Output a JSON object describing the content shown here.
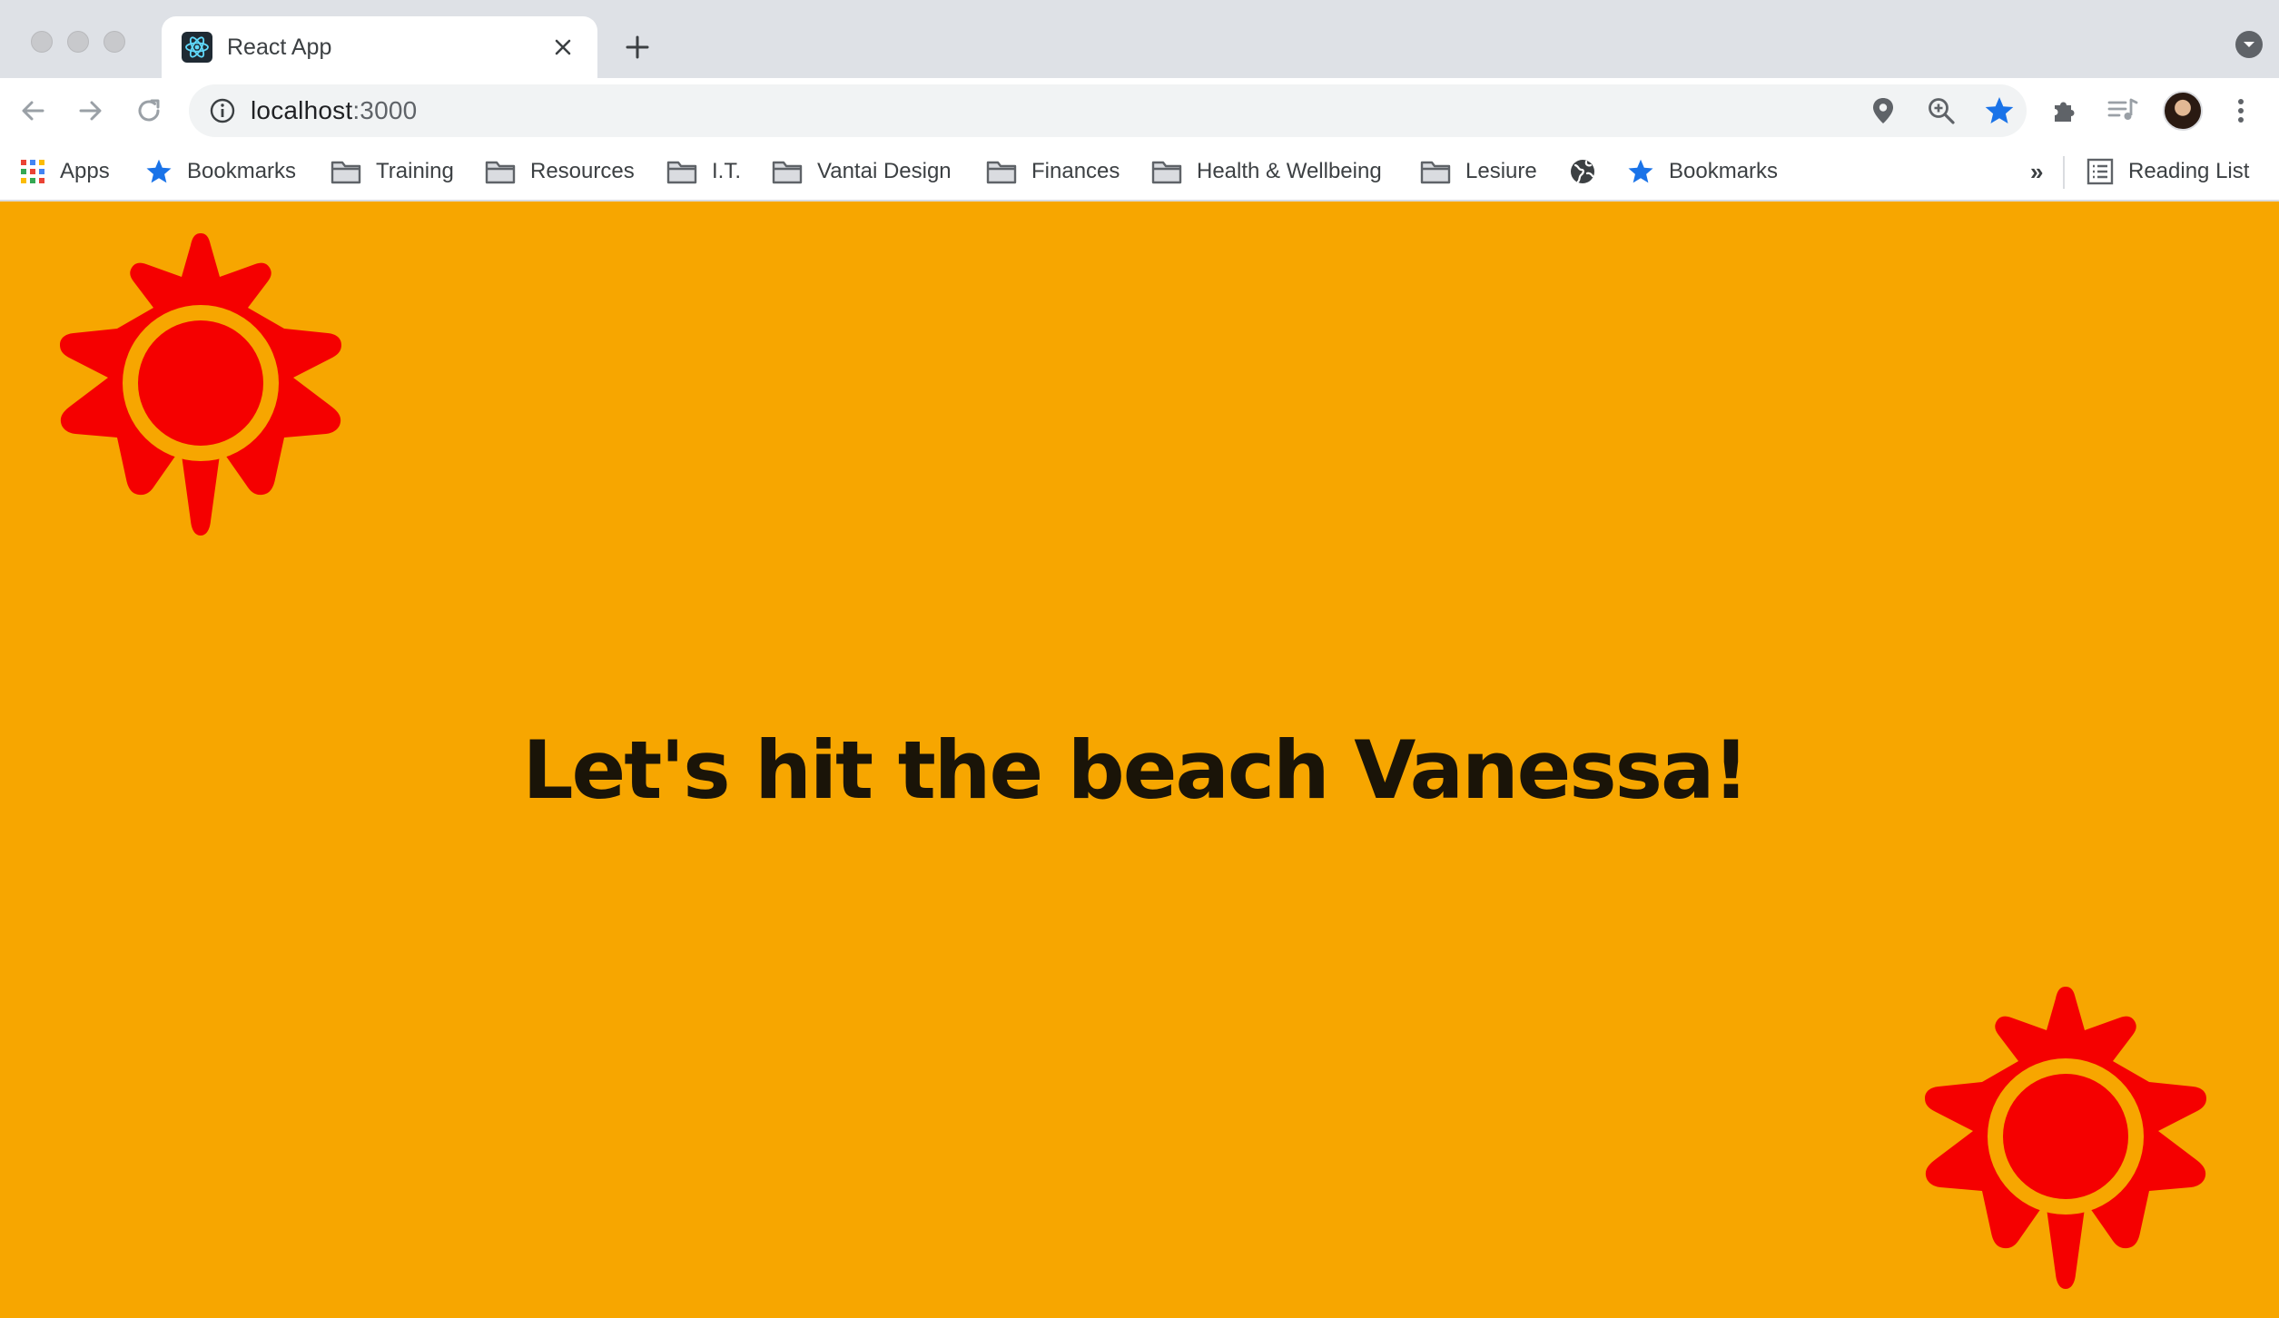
{
  "browser": {
    "tab": {
      "title": "React App",
      "favicon": "react-atom-icon"
    },
    "address_bar": {
      "host": "localhost",
      "port": ":3000"
    },
    "bookmarks": [
      {
        "label": "Apps",
        "icon": "apps-grid-icon"
      },
      {
        "label": "Bookmarks",
        "icon": "star-icon"
      },
      {
        "label": "Training",
        "icon": "folder-icon"
      },
      {
        "label": "Resources",
        "icon": "folder-icon"
      },
      {
        "label": "I.T.",
        "icon": "folder-icon"
      },
      {
        "label": "Vantai Design",
        "icon": "folder-icon"
      },
      {
        "label": "Finances",
        "icon": "folder-icon"
      },
      {
        "label": "Health & Wellbeing",
        "icon": "folder-icon"
      },
      {
        "label": "Lesiure",
        "icon": "folder-icon"
      },
      {
        "label": "",
        "icon": "globe-icon"
      },
      {
        "label": "Bookmarks",
        "icon": "star-icon"
      }
    ],
    "overflow_label": "»",
    "reading_list_label": "Reading List",
    "accent_color": "#1a73e8"
  },
  "page": {
    "headline": "Let's hit the beach Vanessa!",
    "background_color": "#f7a600",
    "sun_color": "#f50000",
    "text_color": "#1a1408",
    "decorations": [
      "sun-icon",
      "sun-icon"
    ]
  }
}
